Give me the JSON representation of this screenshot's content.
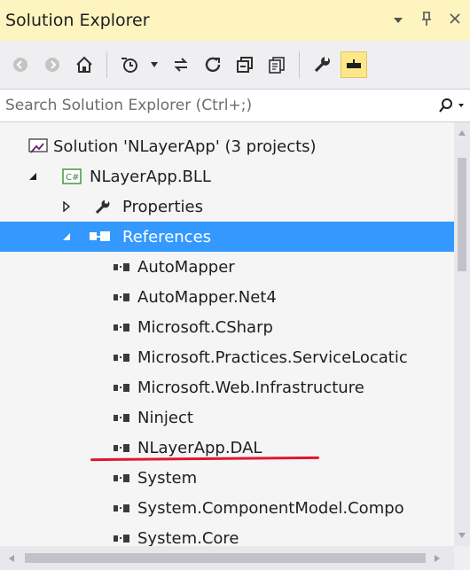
{
  "window": {
    "title": "Solution Explorer",
    "controls": {
      "dropdown": "▾",
      "pin": "ᵮ",
      "close": "✕"
    }
  },
  "toolbar": {
    "buttons": [
      "back-icon",
      "forward-icon",
      "home-icon",
      "pending-changes-icon",
      "dropdown-icon",
      "sync-icon",
      "refresh-icon",
      "collapse-all-icon",
      "show-all-files-icon",
      "properties-wrench-icon",
      "preview-icon"
    ]
  },
  "search": {
    "placeholder": "Search Solution Explorer (Ctrl+;)"
  },
  "tree": {
    "solution": "Solution 'NLayerApp' (3 projects)",
    "project": "NLayerApp.BLL",
    "project_badge": "C#",
    "properties": "Properties",
    "references": "References",
    "reference_items": [
      "AutoMapper",
      "AutoMapper.Net4",
      "Microsoft.CSharp",
      "Microsoft.Practices.ServiceLocatic",
      "Microsoft.Web.Infrastructure",
      "Ninject",
      "NLayerApp.DAL",
      "System",
      "System.ComponentModel.Compo",
      "System.Core"
    ]
  },
  "colors": {
    "title_bar": "#fdf4bf",
    "selection": "#3399ff",
    "annotation_underline": "#e3162c"
  }
}
